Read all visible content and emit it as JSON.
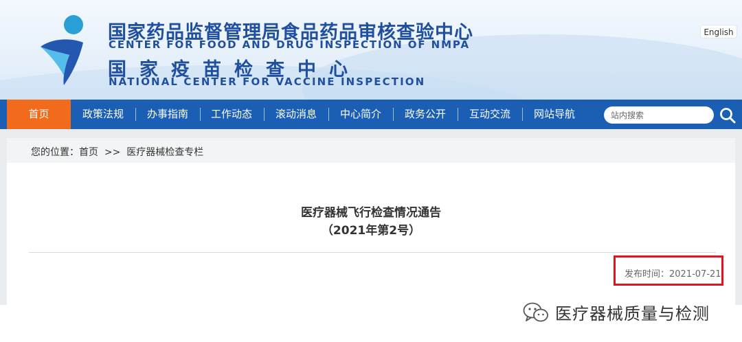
{
  "header": {
    "title_cn_primary": "国家药品监督管理局食品药品审核查验中心",
    "title_en_primary": "CENTER FOR FOOD AND DRUG INSPECTION OF NMPA",
    "title_cn_secondary": "国家疫苗检查中心",
    "title_en_secondary": "NATIONAL CENTER FOR VACCINE INSPECTION",
    "language_button": "English"
  },
  "nav": {
    "items": [
      {
        "label": "首页",
        "active": true
      },
      {
        "label": "政策法规"
      },
      {
        "label": "办事指南"
      },
      {
        "label": "工作动态"
      },
      {
        "label": "滚动消息"
      },
      {
        "label": "中心简介"
      },
      {
        "label": "政务公开"
      },
      {
        "label": "互动交流"
      },
      {
        "label": "网站导航"
      }
    ],
    "search_placeholder": "站内搜索",
    "search_icon": "search-icon"
  },
  "breadcrumb": {
    "prefix": "您的位置：",
    "home": "首页",
    "separator": ">>",
    "current": "医疗器械检查专栏"
  },
  "article": {
    "title": "医疗器械飞行检查情况通告",
    "subtitle": "（2021年第2号）",
    "publish_label": "发布时间：",
    "publish_date": "2021-07-21"
  },
  "watermark": {
    "icon": "wechat-icon",
    "text": "医疗器械质量与检测"
  },
  "colors": {
    "nav_bg": "#1a5fb4",
    "nav_active": "#f26b1d",
    "brand_blue": "#1f4f9e",
    "highlight_box": "#e0141e"
  }
}
